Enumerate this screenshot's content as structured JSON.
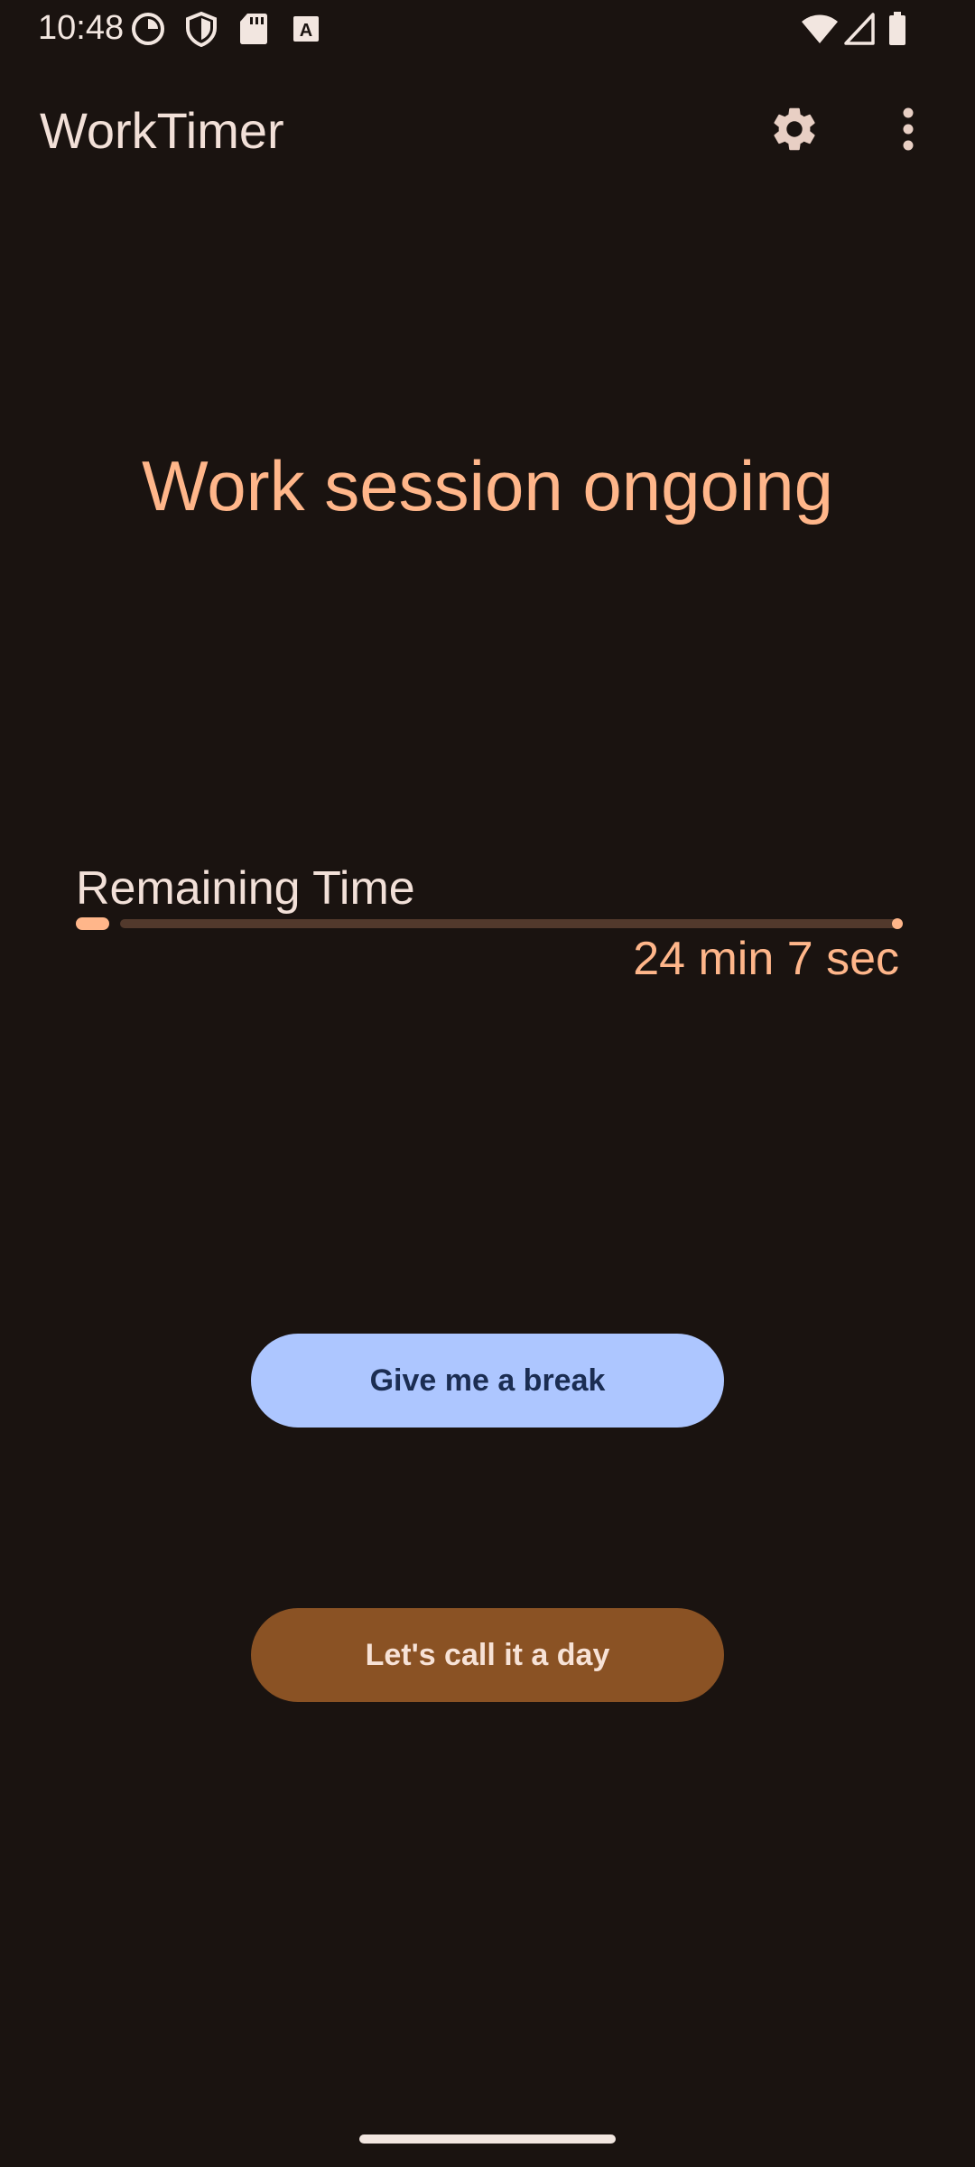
{
  "status_bar": {
    "time": "10:48",
    "left_icons": [
      "pie-clock-icon",
      "shield-icon",
      "sd-card-icon",
      "keyboard-a-icon"
    ],
    "right_icons": [
      "wifi-icon",
      "signal-icon",
      "battery-icon"
    ]
  },
  "app_bar": {
    "title": "WorkTimer",
    "actions": [
      "settings-gear-icon",
      "more-vert-icon"
    ]
  },
  "main": {
    "headline": "Work session ongoing",
    "remaining_label": "Remaining Time",
    "remaining_value": "24 min 7 sec",
    "progress_fraction": 0.04
  },
  "actions": {
    "break_label": "Give me a break",
    "end_day_label": "Let's call it a day"
  },
  "colors": {
    "background": "#1a1310",
    "accent": "#ffb68a",
    "break_button": "#adc6ff",
    "end_day_button": "#8a5224"
  }
}
